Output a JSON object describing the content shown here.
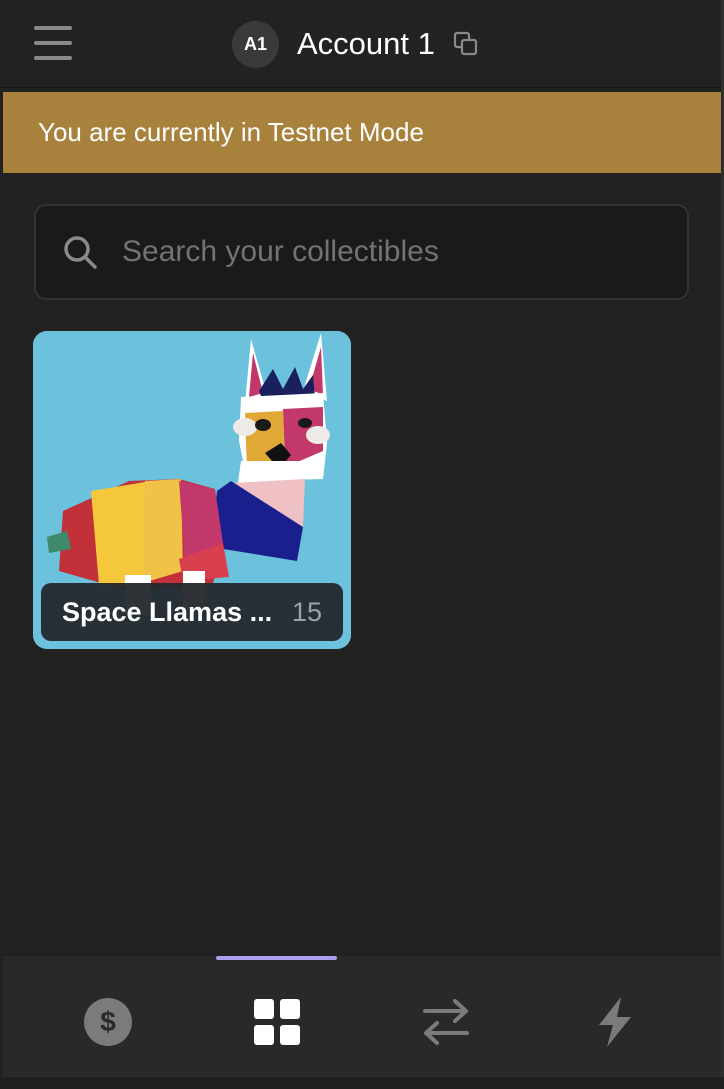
{
  "header": {
    "avatar_initials": "A1",
    "account_name": "Account 1"
  },
  "banner": {
    "text": "You are currently in Testnet Mode"
  },
  "search": {
    "placeholder": "Search your collectibles",
    "value": ""
  },
  "collectibles": [
    {
      "title": "Space Llamas ...",
      "count": "15"
    }
  ],
  "nav": {
    "active": "collectibles",
    "items": [
      {
        "icon": "dollar-icon"
      },
      {
        "icon": "grid-icon"
      },
      {
        "icon": "swap-arrows-icon"
      },
      {
        "icon": "lightning-icon"
      }
    ]
  },
  "colors": {
    "background": "#222222",
    "banner": "#a8823c",
    "accent": "#ab9ff2",
    "card_bg": "#6cc1dc"
  }
}
